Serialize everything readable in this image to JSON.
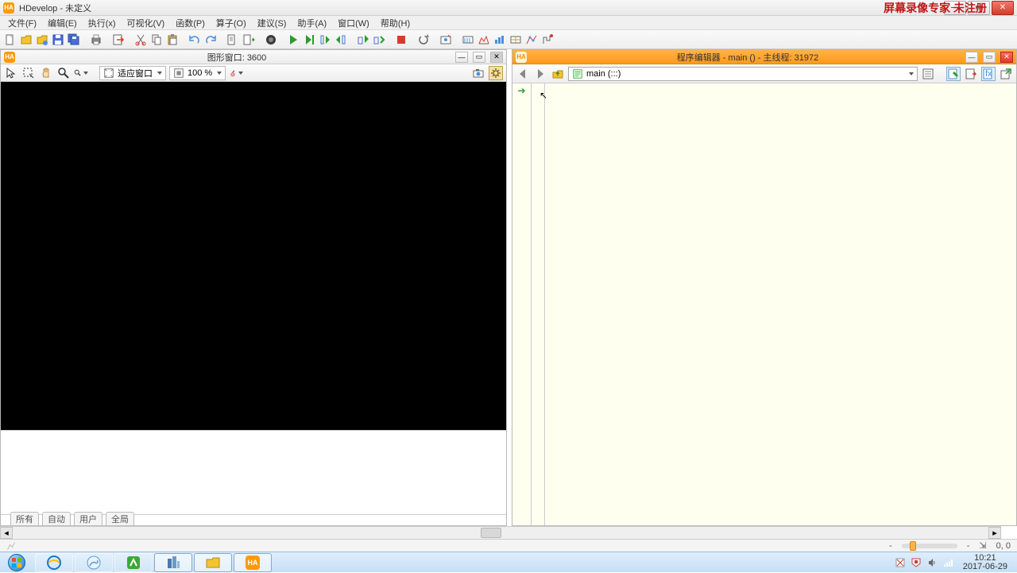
{
  "title": "HDevelop - 未定义",
  "watermark": "屏幕录像专家 未注册",
  "menu": [
    "文件(F)",
    "编辑(E)",
    "执行(x)",
    "可视化(V)",
    "函数(P)",
    "算子(O)",
    "建议(S)",
    "助手(A)",
    "窗口(W)",
    "帮助(H)"
  ],
  "graphics_window": {
    "title": "图形窗口: 3600",
    "fit_label": "适应窗口",
    "zoom_label": "100 %"
  },
  "program_editor": {
    "title": "程序编辑器 - main () - 主线程: 31972",
    "path": "main (:::)"
  },
  "tabs": [
    "所有",
    "自动",
    "用户",
    "全局"
  ],
  "status": {
    "dash": "-",
    "dash2": "-",
    "coords": "0, 0",
    "coords_icon": "⇲"
  },
  "taskbar": {
    "time": "10:21",
    "date": "2017-06-29"
  }
}
